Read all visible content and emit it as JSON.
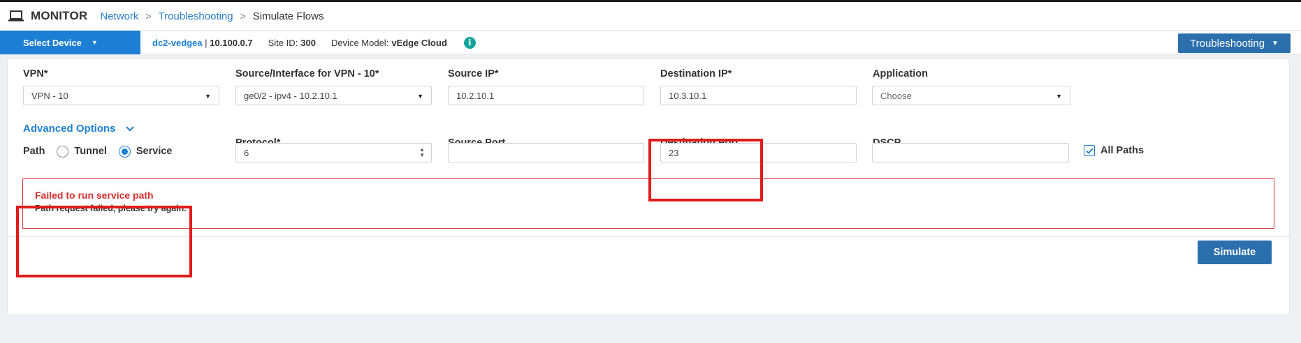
{
  "header": {
    "app_title": "MONITOR",
    "breadcrumb": [
      "Network",
      "Troubleshooting",
      "Simulate Flows"
    ],
    "separator": ">",
    "icon": "laptop-icon"
  },
  "device_bar": {
    "select_device_label": "Select Device",
    "device_name": "dc2-vedgea",
    "divider": " | ",
    "device_ip": "10.100.0.7",
    "site_id_label": "Site ID:",
    "site_id": "300",
    "device_model_label": "Device Model:",
    "device_model": "vEdge Cloud",
    "info_icon_glyph": "i",
    "troubleshooting_label": "Troubleshooting"
  },
  "form": {
    "vpn": {
      "label": "VPN*",
      "value": "VPN - 10"
    },
    "source_interface": {
      "label": "Source/Interface for VPN - 10*",
      "value": "ge0/2 - ipv4 - 10.2.10.1"
    },
    "source_ip": {
      "label": "Source IP*",
      "value": "10.2.10.1"
    },
    "destination_ip": {
      "label": "Destination IP*",
      "value": "10.3.10.1"
    },
    "application": {
      "label": "Application",
      "placeholder": "Choose"
    },
    "advanced_options_label": "Advanced Options",
    "path": {
      "label": "Path",
      "options": [
        "Tunnel",
        "Service"
      ],
      "selected": "Service"
    },
    "protocol": {
      "label": "Protocol*",
      "value": "6"
    },
    "source_port": {
      "label": "Source Port",
      "value": ""
    },
    "destination_port": {
      "label": "Destination Port",
      "value": "23"
    },
    "dscp": {
      "label": "DSCP",
      "value": ""
    },
    "all_paths": {
      "label": "All Paths",
      "checked": true
    }
  },
  "error": {
    "title": "Failed to run service path",
    "message": "Path request failed, please try again."
  },
  "simulate_label": "Simulate",
  "colors": {
    "accent_blue": "#1d7fd4",
    "button_blue": "#2b6fad",
    "error_red": "#d32f2f",
    "highlight_red": "#e21b1b",
    "info_teal": "#12a39a"
  }
}
